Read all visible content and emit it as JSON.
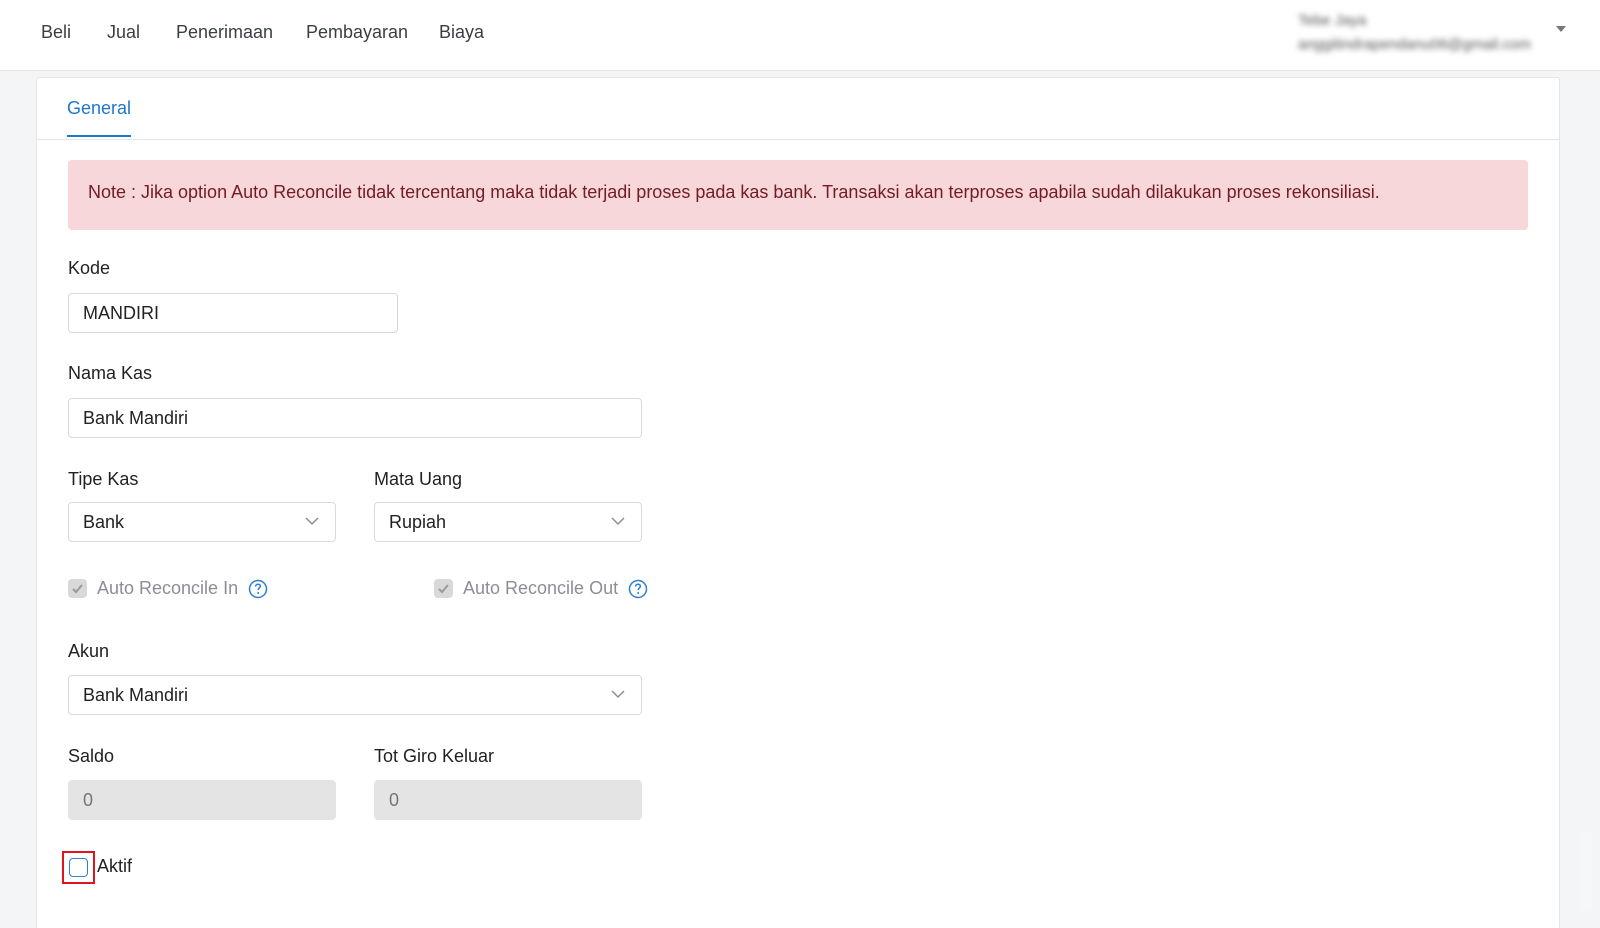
{
  "nav": {
    "items": [
      {
        "label": "Beli"
      },
      {
        "label": "Jual"
      },
      {
        "label": "Penerimaan"
      },
      {
        "label": "Pembayaran"
      },
      {
        "label": "Biaya"
      }
    ]
  },
  "user": {
    "name": "Tebe Jaya",
    "email": "anggitindrapendanu06@gmail.com"
  },
  "tabs": {
    "general": "General"
  },
  "alert": {
    "text": "Note : Jika option Auto Reconcile tidak tercentang maka tidak terjadi proses pada kas bank. Transaksi akan terproses apabila sudah dilakukan proses rekonsiliasi."
  },
  "form": {
    "kode": {
      "label": "Kode",
      "value": "MANDIRI"
    },
    "nama_kas": {
      "label": "Nama Kas",
      "value": "Bank Mandiri"
    },
    "tipe_kas": {
      "label": "Tipe Kas",
      "value": "Bank"
    },
    "mata_uang": {
      "label": "Mata Uang",
      "value": "Rupiah"
    },
    "auto_reconcile_in": {
      "label": "Auto Reconcile In",
      "checked": true,
      "disabled": true
    },
    "auto_reconcile_out": {
      "label": "Auto Reconcile Out",
      "checked": true,
      "disabled": true
    },
    "akun": {
      "label": "Akun",
      "value": "Bank Mandiri"
    },
    "saldo": {
      "label": "Saldo",
      "placeholder": "0"
    },
    "tot_giro_keluar": {
      "label": "Tot Giro Keluar",
      "placeholder": "0"
    },
    "aktif": {
      "label": "Aktif",
      "checked": false
    }
  },
  "colors": {
    "accent": "#1c78c8",
    "alert_bg": "#f8d7da",
    "alert_text": "#721c24",
    "highlight": "#e0141e"
  }
}
